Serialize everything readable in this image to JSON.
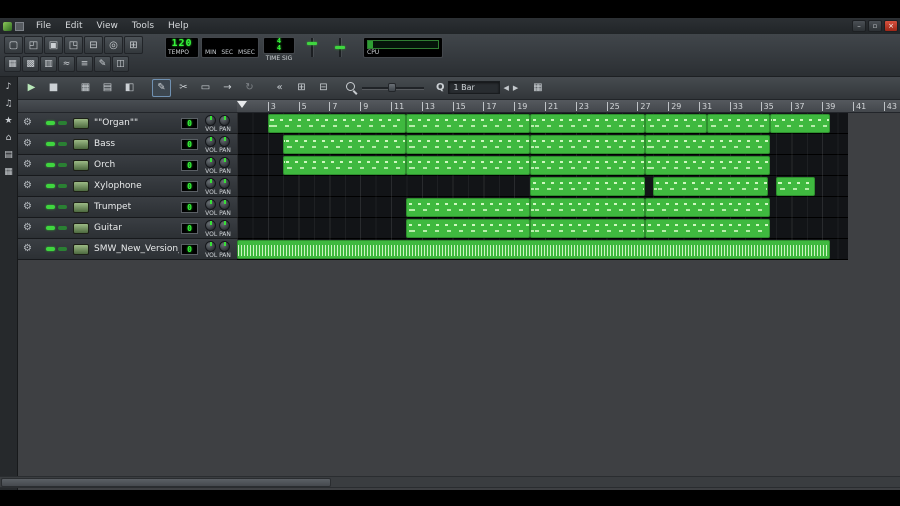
{
  "window": {
    "menu_items": [
      "File",
      "Edit",
      "View",
      "Tools",
      "Help"
    ],
    "controls": [
      {
        "name": "minimize-button",
        "glyph": "–",
        "style": ""
      },
      {
        "name": "restore-button",
        "glyph": "▫",
        "style": ""
      },
      {
        "name": "close-button",
        "glyph": "×",
        "style": "close"
      }
    ]
  },
  "main_toolbar": {
    "buttons": [
      {
        "name": "new-project-button",
        "glyph": "▢"
      },
      {
        "name": "open-project-button",
        "glyph": "◰"
      },
      {
        "name": "save-project-button",
        "glyph": "▣"
      },
      {
        "name": "export-project-button",
        "glyph": "◳"
      },
      {
        "name": "import-button",
        "glyph": "⊟"
      },
      {
        "name": "zoom-button",
        "glyph": "◎"
      },
      {
        "name": "project-properties-button",
        "glyph": "⊞"
      }
    ]
  },
  "editor_toggles": {
    "buttons": [
      {
        "name": "song-editor-toggle",
        "glyph": "▦"
      },
      {
        "name": "bb-editor-toggle",
        "glyph": "▩"
      },
      {
        "name": "piano-roll-toggle",
        "glyph": "▥"
      },
      {
        "name": "automation-editor-toggle",
        "glyph": "≈"
      },
      {
        "name": "fx-mixer-toggle",
        "glyph": "≡"
      },
      {
        "name": "project-notes-toggle",
        "glyph": "✎"
      },
      {
        "name": "controller-rack-toggle",
        "glyph": "◫"
      }
    ]
  },
  "transport": {
    "tempo_value": "120",
    "tempo_label": "TEMPO",
    "time_labels": [
      "MIN",
      "SEC",
      "MSEC"
    ],
    "timesig_top": "4",
    "timesig_bottom": "4",
    "timesig_label": "TIME SIG",
    "cpu_label": "CPU"
  },
  "sidebar": {
    "icons": [
      {
        "name": "instruments-icon",
        "glyph": "♪"
      },
      {
        "name": "samples-icon",
        "glyph": "♫"
      },
      {
        "name": "presets-icon",
        "glyph": "★"
      },
      {
        "name": "home-icon",
        "glyph": "⌂"
      },
      {
        "name": "root-folder-icon",
        "glyph": "▤"
      },
      {
        "name": "computer-icon",
        "glyph": "▦"
      }
    ]
  },
  "song_editor": {
    "toolbar": {
      "buttons": [
        {
          "name": "play-button",
          "glyph": "▶",
          "cls": "play"
        },
        {
          "name": "stop-button",
          "glyph": "■"
        },
        {
          "name": "add-track-button",
          "glyph": "▦",
          "gap": 10
        },
        {
          "name": "add-sample-track-button",
          "glyph": "▤"
        },
        {
          "name": "add-automation-track-button",
          "glyph": "◧"
        },
        {
          "name": "draw-mode-button",
          "glyph": "✎",
          "cls": "active",
          "gap": 10
        },
        {
          "name": "knife-mode-button",
          "glyph": "✂"
        },
        {
          "name": "select-mode-button",
          "glyph": "▭"
        },
        {
          "name": "move-mode-button",
          "glyph": "→"
        },
        {
          "name": "loop-mode-button",
          "glyph": "↻",
          "cls": "dim"
        },
        {
          "name": "back-to-start-button",
          "glyph": "«",
          "gap": 8
        },
        {
          "name": "insert-bar-button",
          "glyph": "⊞"
        },
        {
          "name": "remove-bar-button",
          "glyph": "⊟"
        }
      ],
      "q_label": "Q",
      "zoom_value": "1 Bar",
      "arrows": {
        "left": "◀",
        "right": "▶"
      },
      "grid_glyph": "▦"
    },
    "timeline_bars": [
      3,
      5,
      7,
      9,
      11,
      13,
      15,
      17,
      19,
      21,
      23,
      25,
      27,
      29,
      31,
      33,
      35,
      37,
      39,
      41,
      43
    ],
    "tracks": [
      {
        "name": "\"\"Organ\"\"",
        "number": "0",
        "knob_label": "VOL PAN",
        "type": "notes",
        "segments": [
          [
            3,
            12
          ],
          [
            12,
            20
          ],
          [
            20,
            27.5
          ],
          [
            27.5,
            31.5
          ],
          [
            31.5,
            35.6
          ],
          [
            35.6,
            39.5
          ]
        ]
      },
      {
        "name": "Bass",
        "number": "0",
        "knob_label": "VOL PAN",
        "type": "notes",
        "segments": [
          [
            4,
            12
          ],
          [
            12,
            20
          ],
          [
            20,
            27.5
          ],
          [
            27.5,
            35.6
          ]
        ]
      },
      {
        "name": "Orch",
        "number": "0",
        "knob_label": "VOL PAN",
        "type": "notes",
        "segments": [
          [
            4,
            12
          ],
          [
            12,
            20
          ],
          [
            20,
            27.5
          ],
          [
            27.5,
            35.6
          ]
        ]
      },
      {
        "name": "Xylophone",
        "number": "0",
        "knob_label": "VOL PAN",
        "type": "notes",
        "segments": [
          [
            20,
            27.5
          ],
          [
            28,
            35.5
          ],
          [
            36,
            38.5
          ]
        ]
      },
      {
        "name": "Trumpet",
        "number": "0",
        "knob_label": "VOL PAN",
        "type": "notes",
        "segments": [
          [
            12,
            20
          ],
          [
            20,
            27.5
          ],
          [
            27.5,
            35.6
          ]
        ]
      },
      {
        "name": "Guitar",
        "number": "0",
        "knob_label": "VOL PAN",
        "type": "notes",
        "segments": [
          [
            12,
            20
          ],
          [
            20,
            27.5
          ],
          [
            27.5,
            35.6
          ]
        ]
      },
      {
        "name": "SMW_New_Version_",
        "number": "0",
        "knob_label": "VOL PAN",
        "type": "sample",
        "segments": [
          [
            1,
            39.5
          ]
        ]
      }
    ]
  },
  "colors": {
    "pattern_green": "#3fb93f",
    "led_green": "#35f53a",
    "close_red": "#c0392b",
    "mdi_gray": "#3e4043"
  }
}
